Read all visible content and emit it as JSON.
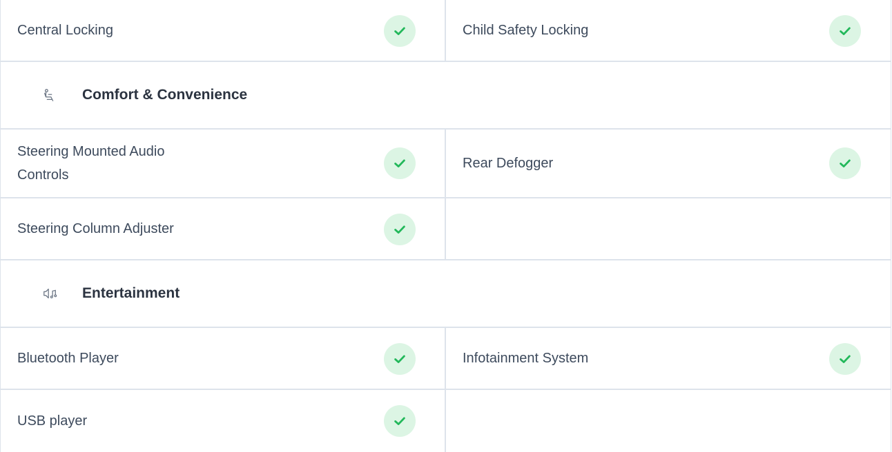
{
  "colors": {
    "check_bg": "#dcf5e4",
    "check_mark": "#22b85a",
    "border": "#dde3eb",
    "text": "#3d4a5c",
    "heading": "#2b3340"
  },
  "rows_top": [
    {
      "left": "Central Locking",
      "right": "Child Safety Locking"
    }
  ],
  "sections": [
    {
      "icon": "seat-icon",
      "title": "Comfort & Convenience",
      "rows": [
        {
          "left": "Steering Mounted Audio Controls",
          "right": "Rear Defogger"
        },
        {
          "left": "Steering Column Adjuster",
          "right": ""
        }
      ]
    },
    {
      "icon": "speaker-music-icon",
      "title": "Entertainment",
      "rows": [
        {
          "left": "Bluetooth Player",
          "right": "Infotainment System"
        },
        {
          "left": "USB player",
          "right": ""
        }
      ]
    }
  ]
}
